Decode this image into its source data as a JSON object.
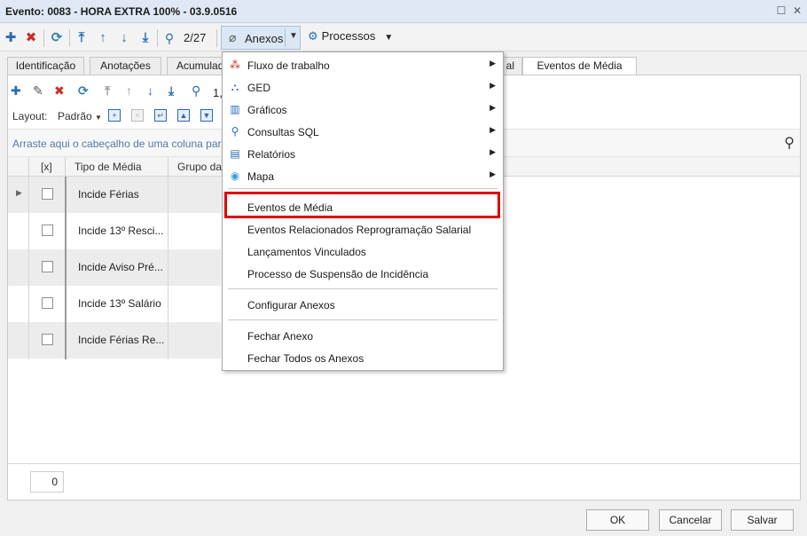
{
  "window": {
    "title": "Evento: 0083 - HORA EXTRA 100% - 03.9.0516"
  },
  "toolbar": {
    "counter": "2/27",
    "anexos_label": "Anexos",
    "processos_label": "Processos"
  },
  "tabs": [
    {
      "label": "Identificação"
    },
    {
      "label": "Anotações"
    },
    {
      "label": "Acumulado"
    },
    {
      "label": "al"
    },
    {
      "label": "Eventos de Média"
    }
  ],
  "grid": {
    "counter_partial": "1,",
    "layout_label": "Layout:",
    "layout_value": "Padrão",
    "group_hint": "Arraste aqui o cabeçalho de uma coluna para agr",
    "columns": [
      "[x]",
      "Tipo de Média",
      "Grupo da M"
    ],
    "rows": [
      {
        "tipo": "Incide Férias"
      },
      {
        "tipo": "Incide 13º Resci..."
      },
      {
        "tipo": "Incide Aviso Pré..."
      },
      {
        "tipo": "Incide 13º Salário"
      },
      {
        "tipo": "Incide Férias Re..."
      }
    ],
    "record_count": "0"
  },
  "menu": {
    "items": [
      {
        "label": "Fluxo de trabalho",
        "icon": "workflow-icon",
        "submenu": true
      },
      {
        "label": "GED",
        "icon": "ged-icon",
        "submenu": true
      },
      {
        "label": "Gráficos",
        "icon": "chart-icon",
        "submenu": true
      },
      {
        "label": "Consultas SQL",
        "icon": "search-icon",
        "submenu": true
      },
      {
        "label": "Relatórios",
        "icon": "report-icon",
        "submenu": true
      },
      {
        "label": "Mapa",
        "icon": "map-pin-icon",
        "submenu": true
      },
      {
        "label": "Eventos de Média",
        "highlighted": true
      },
      {
        "label": "Eventos Relacionados Reprogramação Salarial"
      },
      {
        "label": "Lançamentos Vinculados"
      },
      {
        "label": "Processo de Suspensão de Incidência"
      },
      {
        "label": "Configurar Anexos"
      },
      {
        "label": "Fechar Anexo"
      },
      {
        "label": "Fechar Todos os Anexos"
      }
    ],
    "highlight_color": "#e10000"
  },
  "buttons": {
    "ok": "OK",
    "cancel": "Cancelar",
    "save": "Salvar"
  }
}
